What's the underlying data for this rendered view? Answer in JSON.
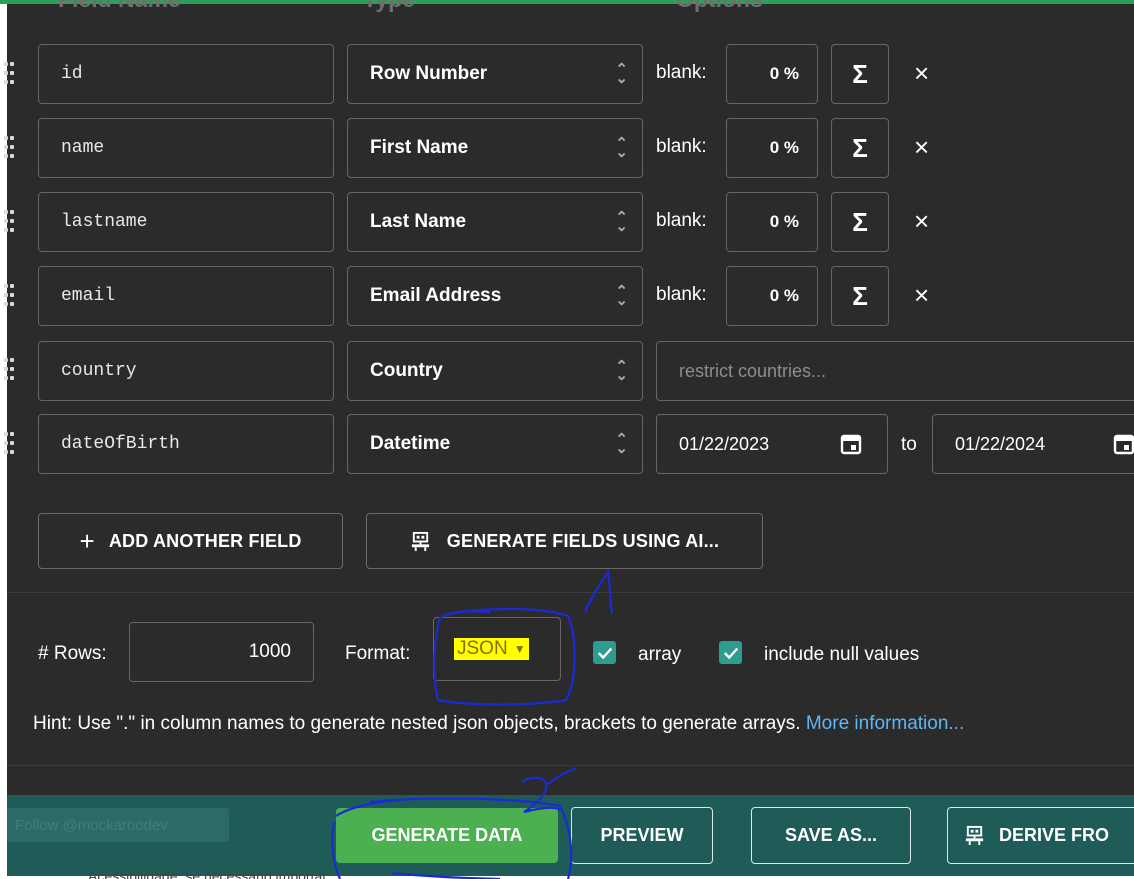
{
  "headers": {
    "field_name": "Field Name",
    "type": "Type",
    "options": "Options"
  },
  "fields": [
    {
      "name": "id",
      "type": "Row Number",
      "blank_label": "blank:",
      "blank_pct": "0 %"
    },
    {
      "name": "name",
      "type": "First Name",
      "blank_label": "blank:",
      "blank_pct": "0 %"
    },
    {
      "name": "lastname",
      "type": "Last Name",
      "blank_label": "blank:",
      "blank_pct": "0 %"
    },
    {
      "name": "email",
      "type": "Email Address",
      "blank_label": "blank:",
      "blank_pct": "0 %"
    },
    {
      "name": "country",
      "type": "Country",
      "placeholder": "restrict countries..."
    },
    {
      "name": "dateOfBirth",
      "type": "Datetime",
      "from": "01/22/2023",
      "to_label": "to",
      "to": "01/22/2024"
    }
  ],
  "icons": {
    "sigma": "Σ",
    "remove": "×",
    "add": "+",
    "ai": "robot-icon",
    "calendar": "calendar-icon",
    "grip": "drag-handle-icon"
  },
  "actions": {
    "add_field": "ADD ANOTHER FIELD",
    "generate_ai": "GENERATE FIELDS USING AI..."
  },
  "options": {
    "rows_label": "# Rows:",
    "rows_value": "1000",
    "format_label": "Format:",
    "format_value": "JSON",
    "array_label": "array",
    "array_checked": true,
    "null_label": "include null values",
    "null_checked": true
  },
  "hint": {
    "text": "Hint: Use \".\" in column names to generate nested json objects, brackets to generate arrays. ",
    "link": "More information..."
  },
  "footer": {
    "follow": "Follow @mockaroodev",
    "generate": "GENERATE DATA",
    "preview": "PREVIEW",
    "save_as": "SAVE AS...",
    "derive": "DERIVE FRO",
    "below_text": "Acessibilidade: se necessário importar"
  },
  "annotations": {
    "one": "1",
    "two": "2"
  },
  "colors": {
    "panel": "#2b2b2b",
    "footer": "#1f5b57",
    "accent_green": "#4caf50",
    "check_teal": "#2e9c8e",
    "link": "#5fb6f2",
    "highlight": "#ffff00",
    "ink": "#1a2bd6"
  }
}
